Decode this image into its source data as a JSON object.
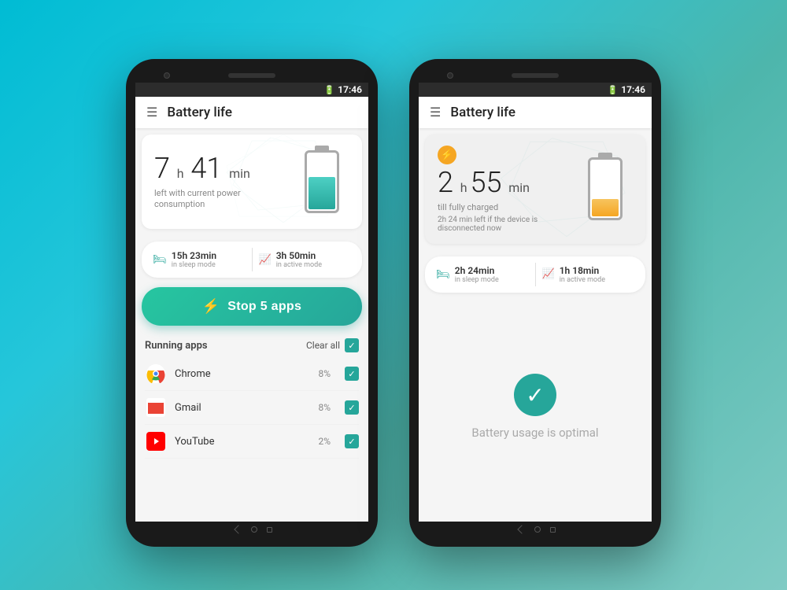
{
  "background": {
    "gradient_start": "#00bcd4",
    "gradient_end": "#80cbc4"
  },
  "phone1": {
    "status_bar": {
      "time": "17:46",
      "battery_icon": "🔋"
    },
    "app_bar": {
      "menu_icon": "☰",
      "title": "Battery life"
    },
    "battery_card": {
      "hours": "7",
      "h_unit": "h",
      "minutes": "41",
      "min_unit": "min",
      "subtext": "left with current power consumption",
      "battery_level": "green"
    },
    "sleep_active": {
      "sleep_icon": "🛏",
      "sleep_time": "15h 23min",
      "sleep_label": "in sleep mode",
      "active_icon": "📈",
      "active_time": "3h 50min",
      "active_label": "in active mode"
    },
    "stop_button": {
      "label": "Stop 5 apps",
      "lightning": "⚡"
    },
    "running_apps": {
      "title": "Running apps",
      "clear_all": "Clear all",
      "apps": [
        {
          "name": "Chrome",
          "icon": "chrome",
          "percent": "8%",
          "checked": true
        },
        {
          "name": "Gmail",
          "icon": "gmail",
          "percent": "8%",
          "checked": true
        },
        {
          "name": "YouTube",
          "icon": "youtube",
          "percent": "2%",
          "checked": true
        }
      ]
    }
  },
  "phone2": {
    "status_bar": {
      "time": "17:46",
      "battery_icon": "🔋"
    },
    "app_bar": {
      "menu_icon": "☰",
      "title": "Battery life"
    },
    "battery_card": {
      "charging_icon": "⚡",
      "hours": "2",
      "h_unit": "h",
      "minutes": "55",
      "min_unit": "min",
      "subtext": "till fully charged",
      "disconnected_text": "2h 24 min left if the device is disconnected now",
      "battery_level": "yellow"
    },
    "sleep_active": {
      "sleep_icon": "🛏",
      "sleep_time": "2h 24min",
      "sleep_label": "in sleep mode",
      "active_icon": "📈",
      "active_time": "1h 18min",
      "active_label": "in active mode"
    },
    "optimal": {
      "checkmark": "✓",
      "text": "Battery usage is optimal"
    }
  }
}
